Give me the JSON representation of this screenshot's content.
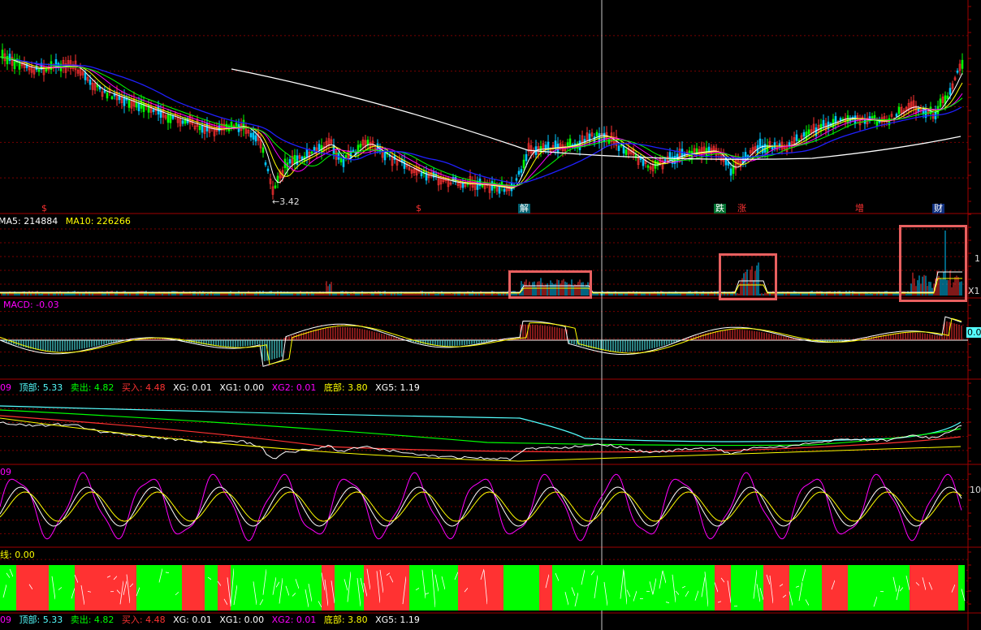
{
  "colors": {
    "background": "#000000",
    "grid": "#7a0000",
    "separator": "#a00000",
    "crosshair": "#c8c8c8",
    "up": "#ff3232",
    "down": "#00c8ff",
    "white": "#ffffff",
    "yellow": "#ffff00",
    "magenta": "#ff00ff",
    "green": "#00ff00",
    "cyan": "#54ffff",
    "blue": "#2020ff",
    "highlight_box": "#e86060"
  },
  "price_panel": {
    "low_label": "←3.42",
    "event_markers": [
      {
        "text": "$",
        "color": "#ff3232",
        "boxed": false
      },
      {
        "text": "$",
        "color": "#ff3232",
        "boxed": false
      },
      {
        "text": "解",
        "color": "#ffffff",
        "boxed": true,
        "box_color": "#006070"
      },
      {
        "text": "跌",
        "color": "#ffffff",
        "boxed": true,
        "box_color": "#007030"
      },
      {
        "text": "涨",
        "color": "#ff3232",
        "boxed": false
      },
      {
        "text": "增",
        "color": "#ff3232",
        "boxed": false
      },
      {
        "text": "财",
        "color": "#ffffff",
        "boxed": true,
        "box_color": "#103080"
      }
    ]
  },
  "volume_panel": {
    "legend": [
      {
        "text": "MA5: 214884",
        "color": "#ffffff"
      },
      {
        "text": "MA10: 226266",
        "color": "#ffff00"
      }
    ],
    "axis_tick": "1",
    "axis_unit": "X1"
  },
  "macd_panel": {
    "legend": [
      {
        "text": "MACD: -0.03",
        "color": "#ff00ff"
      }
    ],
    "zero_label": "0.0"
  },
  "indicator_legend_top": [
    {
      "text": "09",
      "color": "#ff00ff"
    },
    {
      "text": "顶部: 5.33",
      "color": "#54ffff"
    },
    {
      "text": "卖出: 4.82",
      "color": "#00ff00"
    },
    {
      "text": "买入: 4.48",
      "color": "#ff3232"
    },
    {
      "text": "XG: 0.01",
      "color": "#ffffff"
    },
    {
      "text": "XG1: 0.00",
      "color": "#ffffff"
    },
    {
      "text": "XG2: 0.01",
      "color": "#ff00ff"
    },
    {
      "text": "底部: 3.80",
      "color": "#ffff00"
    },
    {
      "text": "XG5: 1.19",
      "color": "#ffffff"
    }
  ],
  "kdj_panel": {
    "legend": [
      {
        "text": "09",
        "color": "#ff00ff"
      }
    ],
    "axis_tick": "10"
  },
  "signal_panel": {
    "legend": [
      {
        "text": "线: 0.00",
        "color": "#ffff00"
      }
    ]
  },
  "indicator_legend_bottom": [
    {
      "text": "09",
      "color": "#ff00ff"
    },
    {
      "text": "顶部: 5.33",
      "color": "#54ffff"
    },
    {
      "text": "卖出: 4.82",
      "color": "#00ff00"
    },
    {
      "text": "买入: 4.48",
      "color": "#ff3232"
    },
    {
      "text": "XG: 0.01",
      "color": "#ffffff"
    },
    {
      "text": "XG1: 0.00",
      "color": "#ffffff"
    },
    {
      "text": "XG2: 0.01",
      "color": "#ff00ff"
    },
    {
      "text": "底部: 3.80",
      "color": "#ffff00"
    },
    {
      "text": "XG5: 1.19",
      "color": "#ffffff"
    }
  ]
}
